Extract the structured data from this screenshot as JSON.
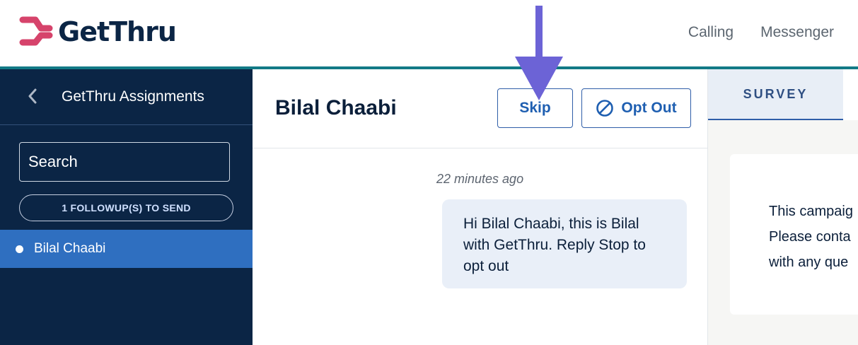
{
  "header": {
    "logo_text": "GetThru",
    "nav": [
      "Calling",
      "Messenger"
    ]
  },
  "sidebar": {
    "title": "GetThru Assignments",
    "search_placeholder": "Search",
    "followup_label": "1 FOLLOWUP(S) TO SEND",
    "items": [
      {
        "label": "Bilal Chaabi"
      }
    ]
  },
  "conversation": {
    "contact_name": "Bilal Chaabi",
    "skip_label": "Skip",
    "optout_label": "Opt Out",
    "messages": [
      {
        "timestamp": "22 minutes ago",
        "lines": [
          "Hi Bilal Chaabi, this is Bilal",
          "with GetThru. Reply Stop to",
          "opt out"
        ]
      }
    ]
  },
  "survey_panel": {
    "tab_label": "SURVEY",
    "card_lines": [
      "This campaig",
      "Please conta",
      "with any que"
    ]
  },
  "colors": {
    "brand_navy": "#0b2545",
    "logo_pink": "#d6436b",
    "accent_teal": "#127a86",
    "active_item": "#2f6fc0",
    "button_blue": "#1f5fb1",
    "annotation_arrow": "#6c63d6"
  },
  "icons": {
    "logo": "gethru-logo-icon",
    "back": "chevron-left-icon",
    "optout": "ban-icon",
    "status": "dot-icon",
    "annotation": "down-arrow-icon"
  }
}
